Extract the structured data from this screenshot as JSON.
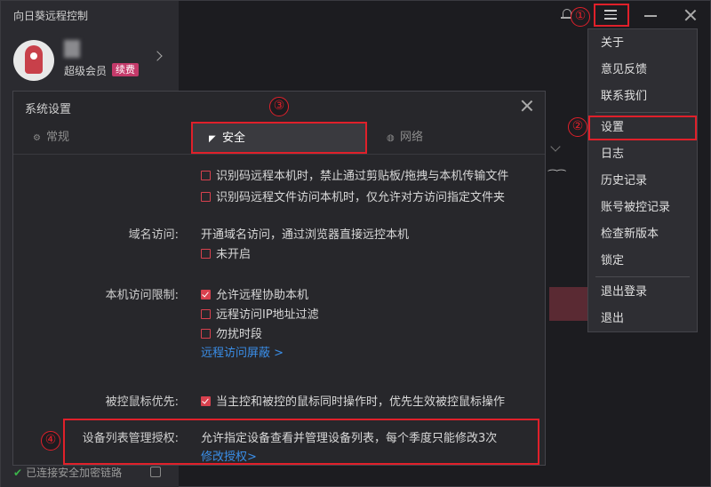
{
  "app": {
    "title": "向日葵远程控制"
  },
  "user": {
    "vip_label": "超级会员",
    "renew_badge": "续费"
  },
  "sidebar": {
    "status_text": "已连接安全加密链路"
  },
  "markers": [
    "①",
    "②",
    "③",
    "④"
  ],
  "dialog": {
    "title": "系统设置",
    "tabs": [
      {
        "label": "常规",
        "icon": "gear-icon"
      },
      {
        "label": "安全",
        "icon": "shield-icon",
        "active": true
      },
      {
        "label": "网络",
        "icon": "globe-icon"
      }
    ],
    "rows": {
      "partial_top": "识别码远程本机时，禁止通过剪贴板/拖拽与本机传输文件",
      "file_access": "识别码远程文件访问本机时，仅允许对方访问指定文件夹",
      "domain_label": "域名访问:",
      "domain_desc": "开通域名访问，通过浏览器直接远控本机",
      "domain_off": "未开启",
      "restrict_label": "本机访问限制:",
      "allow_assist": "允许远程协助本机",
      "ip_filter": "远程访问IP地址过滤",
      "dnd": "勿扰时段",
      "mask_link": "远程访问屏蔽 >",
      "mouse_label": "被控鼠标优先:",
      "mouse_desc": "当主控和被控的鼠标同时操作时，优先生效被控鼠标操作",
      "auth_label": "设备列表管理授权:",
      "auth_desc": "允许指定设备查看并管理设备列表，每个季度只能修改3次",
      "auth_link": "修改授权>"
    }
  },
  "menu": {
    "items": [
      "关于",
      "意见反馈",
      "联系我们",
      "设置",
      "日志",
      "历史记录",
      "账号被控记录",
      "检查新版本",
      "锁定",
      "退出登录",
      "退出"
    ],
    "highlighted": "设置"
  },
  "colors": {
    "accent_red": "#e0202a",
    "checkbox": "#d8414e",
    "link": "#3a8ee8",
    "badge": "#c43a6a"
  }
}
